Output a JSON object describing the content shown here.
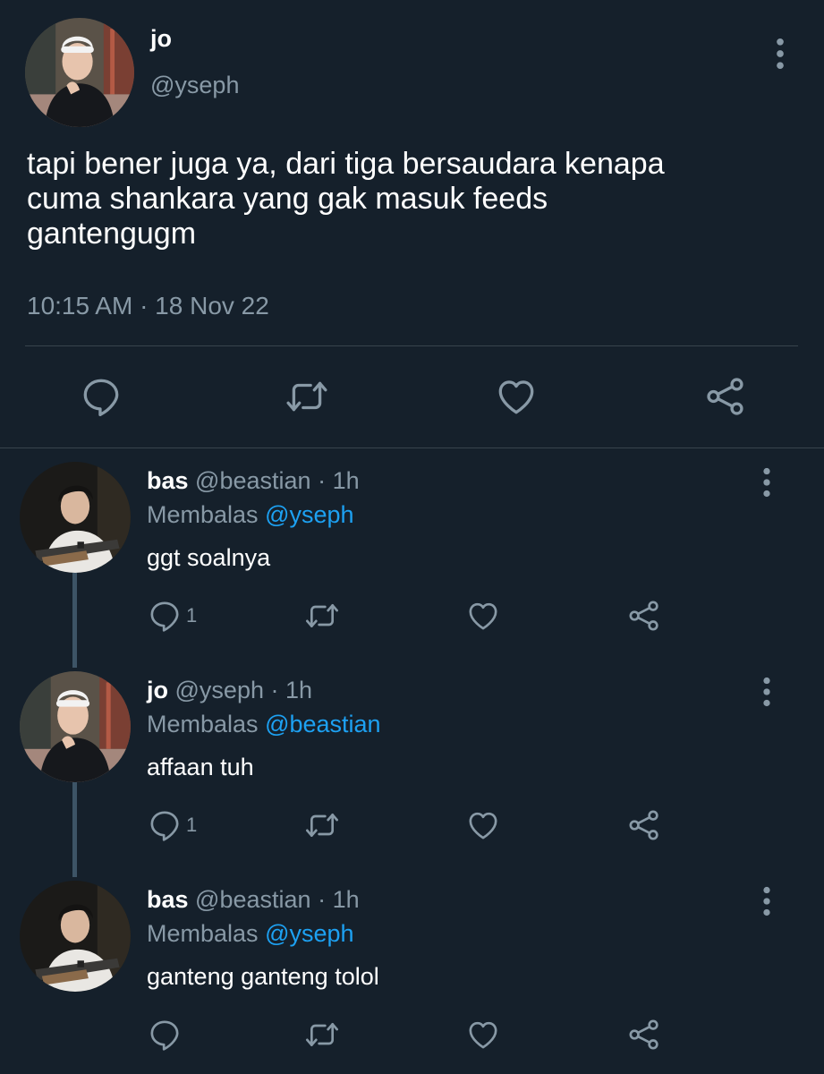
{
  "main_tweet": {
    "author_name": "jo",
    "author_handle": "@yseph",
    "text_lines": [
      "tapi bener juga ya, dari tiga bersaudara kenapa",
      "cuma shankara yang gak masuk feeds",
      "gantengugm"
    ],
    "timestamp": "10:15 AM · 18 Nov 22",
    "actions": [
      "reply-icon",
      "retweet-icon",
      "like-icon",
      "share-icon"
    ]
  },
  "replies": [
    {
      "name": "bas",
      "handle": "@beastian",
      "separator": "·",
      "time": "1h",
      "replying_label": "Membalas",
      "replying_to": "@yseph",
      "text": "ggt soalnya",
      "reply_count": "1"
    },
    {
      "name": "jo",
      "handle": "@yseph",
      "separator": "·",
      "time": "1h",
      "replying_label": "Membalas",
      "replying_to": "@beastian",
      "text": "affaan tuh",
      "reply_count": "1"
    },
    {
      "name": "bas",
      "handle": "@beastian",
      "separator": "·",
      "time": "1h",
      "replying_label": "Membalas",
      "replying_to": "@yseph",
      "text": "ganteng ganteng tolol",
      "reply_count": ""
    }
  ],
  "colors": {
    "background": "#15202b",
    "secondary_text": "#8899a6",
    "mention": "#1da1f2",
    "divider": "#38444d",
    "thread_line": "#3d5466"
  }
}
